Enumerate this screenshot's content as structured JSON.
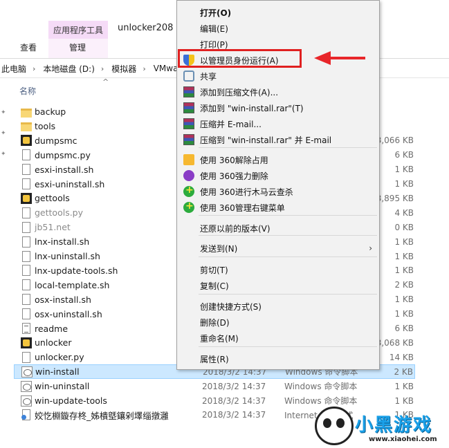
{
  "ribbon": {
    "app_tools_label": "应用程序工具",
    "window_title": "unlocker208",
    "tab_view": "查看",
    "tab_manage": "管理"
  },
  "breadcrumb": [
    "此电脑",
    "本地磁盘 (D:)",
    "模拟器",
    "VMwa"
  ],
  "file_list": {
    "column_name": "名称",
    "files": [
      {
        "name": "backup",
        "icon": "folder-icon",
        "date": "",
        "type": "",
        "size": ""
      },
      {
        "name": "tools",
        "icon": "folder-icon",
        "date": "",
        "type": "",
        "size": ""
      },
      {
        "name": "dumpsmc",
        "icon": "exe-icon",
        "date": "",
        "type": "",
        "size": "3,066 KB"
      },
      {
        "name": "dumpsmc.py",
        "icon": "file-icon",
        "date": "",
        "type": "",
        "size": "6 KB"
      },
      {
        "name": "esxi-install.sh",
        "icon": "file-icon",
        "date": "",
        "type": "",
        "size": "1 KB"
      },
      {
        "name": "esxi-uninstall.sh",
        "icon": "file-icon",
        "date": "",
        "type": "",
        "size": "1 KB"
      },
      {
        "name": "gettools",
        "icon": "exe-icon",
        "date": "",
        "type": "",
        "size": "3,895 KB"
      },
      {
        "name": "gettools.py",
        "icon": "file-icon",
        "date": "",
        "type": "",
        "size": "4 KB"
      },
      {
        "name": "jb51.net",
        "icon": "file-icon",
        "date": "",
        "type": "",
        "size": "0 KB"
      },
      {
        "name": "lnx-install.sh",
        "icon": "file-icon",
        "date": "",
        "type": "",
        "size": "1 KB"
      },
      {
        "name": "lnx-uninstall.sh",
        "icon": "file-icon",
        "date": "",
        "type": "",
        "size": "1 KB"
      },
      {
        "name": "lnx-update-tools.sh",
        "icon": "file-icon",
        "date": "",
        "type": "",
        "size": "1 KB"
      },
      {
        "name": "local-template.sh",
        "icon": "file-icon",
        "date": "",
        "type": "",
        "size": "2 KB"
      },
      {
        "name": "osx-install.sh",
        "icon": "file-icon",
        "date": "",
        "type": "",
        "size": "1 KB"
      },
      {
        "name": "osx-uninstall.sh",
        "icon": "file-icon",
        "date": "",
        "type": "",
        "size": "1 KB"
      },
      {
        "name": "readme",
        "icon": "text-file-icon",
        "date": "",
        "type": "",
        "size": "6 KB"
      },
      {
        "name": "unlocker",
        "icon": "exe-icon",
        "date": "",
        "type": "",
        "size": "3,068 KB"
      },
      {
        "name": "unlocker.py",
        "icon": "file-icon",
        "date": "",
        "type": "",
        "size": "14 KB"
      },
      {
        "name": "win-install",
        "icon": "batch-file-icon",
        "date": "2018/3/2 14:37",
        "type": "Windows 命令脚本",
        "size": "2 KB"
      },
      {
        "name": "win-uninstall",
        "icon": "batch-file-icon",
        "date": "2018/3/2 14:37",
        "type": "Windows 命令脚本",
        "size": "1 KB"
      },
      {
        "name": "win-update-tools",
        "icon": "batch-file-icon",
        "date": "2018/3/2 14:37",
        "type": "Windows 命令脚本",
        "size": "1 KB"
      },
      {
        "name": "姣忔棩鏇存柊_姊樻墍鑲剁墿缁撴灉",
        "icon": "internet-shortcut-icon",
        "date": "2018/3/2 14:37",
        "type": "Internet 快捷方式",
        "size": "1 KB"
      }
    ]
  },
  "context_menu": {
    "items": [
      {
        "label": "打开(O)",
        "icon": "",
        "bold": true
      },
      {
        "label": "编辑(E)",
        "icon": ""
      },
      {
        "label": "打印(P)",
        "icon": ""
      },
      {
        "label": "以管理员身份运行(A)",
        "icon": "uac-shield-icon"
      },
      {
        "label": "共享",
        "icon": "share-icon"
      },
      {
        "label": "添加到压缩文件(A)...",
        "icon": "winrar-icon"
      },
      {
        "label": "添加到 \"win-install.rar\"(T)",
        "icon": "winrar-icon"
      },
      {
        "label": "压缩并 E-mail...",
        "icon": "winrar-icon"
      },
      {
        "label": "压缩到 \"win-install.rar\" 并 E-mail",
        "icon": "winrar-icon"
      },
      {
        "label": "使用 360解除占用",
        "icon": "360-unlock-icon"
      },
      {
        "label": "使用 360强力删除",
        "icon": "360-delete-icon"
      },
      {
        "label": "使用 360进行木马云查杀",
        "icon": "360-scan-icon"
      },
      {
        "label": "使用 360管理右键菜单",
        "icon": "360-scan-icon"
      },
      {
        "label": "还原以前的版本(V)",
        "icon": ""
      },
      {
        "label": "发送到(N)",
        "icon": "",
        "submenu": true
      },
      {
        "label": "剪切(T)",
        "icon": ""
      },
      {
        "label": "复制(C)",
        "icon": ""
      },
      {
        "label": "创建快捷方式(S)",
        "icon": ""
      },
      {
        "label": "删除(D)",
        "icon": ""
      },
      {
        "label": "重命名(M)",
        "icon": ""
      },
      {
        "label": "属性(R)",
        "icon": ""
      }
    ]
  },
  "colors": {
    "highlight": "#e02020",
    "selection": "#cce8ff",
    "app_tools": "#f5dbf7"
  },
  "watermark": {
    "text": "小黑游戏",
    "url": "www.xiaohei.com"
  }
}
